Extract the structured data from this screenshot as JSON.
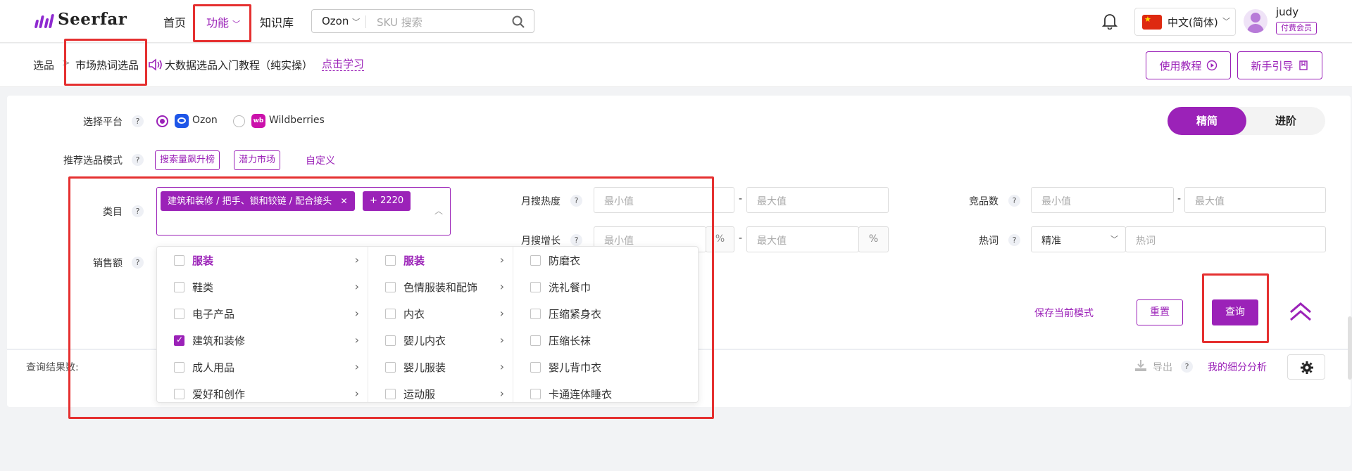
{
  "nav": {
    "brand": "Seerfar",
    "home": "首页",
    "features": "功能",
    "knowledge": "知识库",
    "sku_platform": "Ozon",
    "sku_placeholder": "SKU 搜索",
    "language": "中文(简体)",
    "username": "judy",
    "member_badge": "付费会员"
  },
  "breadcrumb": {
    "root": "选品",
    "current": "市场热词选品",
    "tutorial_text": "大数据选品入门教程（纯实操）",
    "learn_link": "点击学习",
    "guide_button": "使用教程",
    "newbie_button": "新手引导"
  },
  "form": {
    "platform_label": "选择平台",
    "platforms": [
      "Ozon",
      "Wildberries"
    ],
    "mode_toggle": [
      "精简",
      "进阶"
    ],
    "mode_label": "推荐选品模式",
    "mode_tags": [
      "搜索量飙升榜",
      "潜力市场"
    ],
    "mode_custom": "自定义",
    "category_label": "类目",
    "category_chip": "建筑和装修 / 把手、锁和铰链 / 配合接头",
    "category_more": "+ 2220",
    "sales_label": "销售额",
    "monthly_heat_label": "月搜热度",
    "monthly_growth_label": "月搜增长",
    "competitor_label": "竞品数",
    "keyword_label": "热词",
    "min_ph": "最小值",
    "max_ph": "最大值",
    "percent": "%",
    "dash": "-",
    "keyword_match": "精准",
    "keyword_ph": "热词",
    "help": "?"
  },
  "dropdown": {
    "col1": [
      {
        "label": "服装",
        "checked": false,
        "highlight": true
      },
      {
        "label": "鞋类",
        "checked": false,
        "highlight": false
      },
      {
        "label": "电子产品",
        "checked": false,
        "highlight": false
      },
      {
        "label": "建筑和装修",
        "checked": true,
        "highlight": false
      },
      {
        "label": "成人用品",
        "checked": false,
        "highlight": false
      },
      {
        "label": "爱好和创作",
        "checked": false,
        "highlight": false
      }
    ],
    "col2": [
      {
        "label": "服装",
        "checked": false,
        "highlight": true
      },
      {
        "label": "色情服装和配饰",
        "checked": false,
        "highlight": false
      },
      {
        "label": "内衣",
        "checked": false,
        "highlight": false
      },
      {
        "label": "婴儿内衣",
        "checked": false,
        "highlight": false
      },
      {
        "label": "婴儿服装",
        "checked": false,
        "highlight": false
      },
      {
        "label": "运动服",
        "checked": false,
        "highlight": false
      }
    ],
    "col3": [
      {
        "label": "防磨衣",
        "checked": false
      },
      {
        "label": "洗礼餐巾",
        "checked": false
      },
      {
        "label": "压缩紧身衣",
        "checked": false
      },
      {
        "label": "压缩长袜",
        "checked": false
      },
      {
        "label": "婴儿背巾衣",
        "checked": false
      },
      {
        "label": "卡通连体睡衣",
        "checked": false
      }
    ]
  },
  "actions": {
    "save_mode": "保存当前模式",
    "reset": "重置",
    "query": "查询"
  },
  "results": {
    "count_label": "查询结果数:",
    "export": "导出",
    "my_analysis": "我的细分分析"
  },
  "colors": {
    "brand": "#9b22b8",
    "annotation_red": "#e53030"
  }
}
